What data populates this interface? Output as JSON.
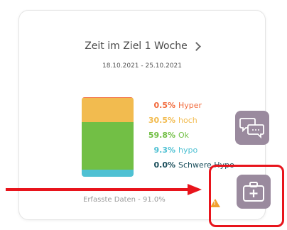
{
  "card": {
    "title": "Zeit im Ziel 1 Woche",
    "date_range": "18.10.2021 - 25.10.2021",
    "footer": "Erfasste Daten - 91.0%"
  },
  "time_in_range": {
    "segments": [
      {
        "label": "Hyper",
        "percent": "0.5%",
        "value": 0.5,
        "color": "#f2693a"
      },
      {
        "label": "hoch",
        "percent": "30.5%",
        "value": 30.5,
        "color": "#f2bb4f"
      },
      {
        "label": "Ok",
        "percent": "59.8%",
        "value": 59.8,
        "color": "#72bf45"
      },
      {
        "label": "hypo",
        "percent": "9.3%",
        "value": 9.3,
        "color": "#4fc1d3"
      },
      {
        "label": "Schwere Hypo",
        "percent": "0.0%",
        "value": 0.0,
        "color": "#1b4f5c"
      }
    ]
  },
  "icons": {
    "chevron": "chevron-right-icon",
    "warning": "warning-icon",
    "chat": "chat-icon",
    "medical_kit": "medical-kit-icon"
  },
  "annotation": {
    "arrow_color": "#e8141c",
    "highlight_color": "#e8141c"
  }
}
